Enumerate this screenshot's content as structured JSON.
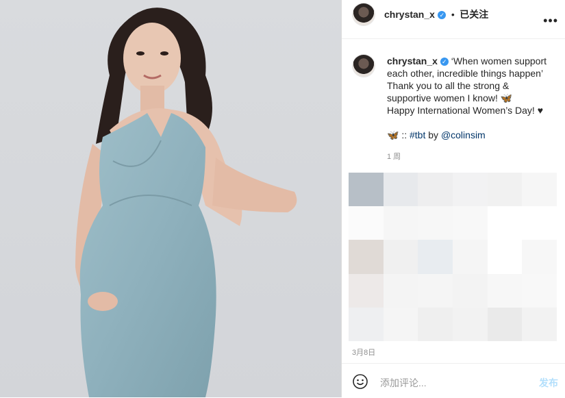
{
  "post": {
    "username": "chrystan_x",
    "verified_icon": "verified-badge-icon",
    "follow_label": "已关注",
    "caption_line1": "‘When women support each other, incredible things happen’",
    "caption_line2": "Thank you to all the strong & supportive women I know! 🦋",
    "caption_line3": "Happy International Women’s Day! ♥",
    "credit_prefix": "🦋 :: ",
    "hashtag": "#tbt",
    "credit_by": " by ",
    "mention": "@colinsim",
    "caption_age": "1 周",
    "post_date": "3月8日"
  },
  "comment": {
    "placeholder": "添加评论...",
    "post_label": "发布"
  },
  "colors": {
    "verified": "#3897f0",
    "link": "#003569",
    "post_disabled": "#b2dffc"
  }
}
